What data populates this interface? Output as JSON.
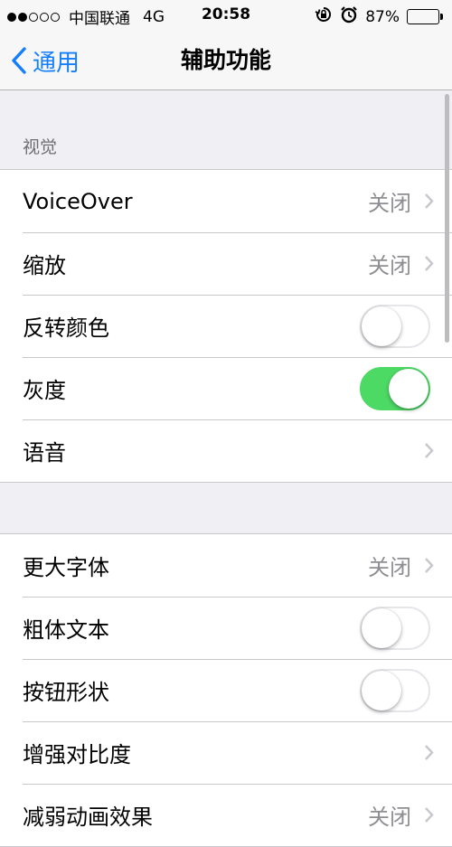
{
  "status_bar": {
    "carrier": "中国联通",
    "network": "4G",
    "time": "20:58",
    "battery_percent_text": "87%",
    "battery_level": 0.87
  },
  "nav": {
    "back_label": "通用",
    "title": "辅助功能"
  },
  "sections": [
    {
      "header": "视觉",
      "rows": [
        {
          "label": "VoiceOver",
          "value": "关闭",
          "type": "disclosure"
        },
        {
          "label": "缩放",
          "value": "关闭",
          "type": "disclosure"
        },
        {
          "label": "反转颜色",
          "type": "toggle",
          "on": false
        },
        {
          "label": "灰度",
          "type": "toggle",
          "on": true
        },
        {
          "label": "语音",
          "type": "disclosure"
        }
      ]
    },
    {
      "header": "",
      "rows": [
        {
          "label": "更大字体",
          "value": "关闭",
          "type": "disclosure"
        },
        {
          "label": "粗体文本",
          "type": "toggle",
          "on": false
        },
        {
          "label": "按钮形状",
          "type": "toggle",
          "on": false
        },
        {
          "label": "增强对比度",
          "type": "disclosure"
        },
        {
          "label": "减弱动画效果",
          "value": "关闭",
          "type": "disclosure"
        }
      ]
    }
  ],
  "colors": {
    "accent": "#147efb",
    "toggle_on": "#4cd964",
    "secondary_text": "#8e8e93",
    "background": "#efeff4"
  }
}
